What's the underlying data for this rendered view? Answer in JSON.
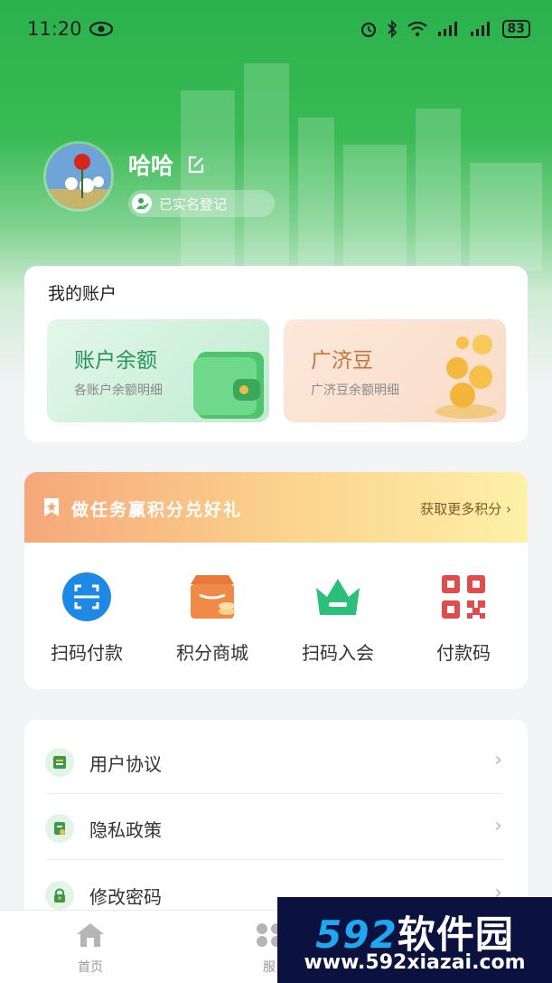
{
  "status_bar": {
    "time": "11:20",
    "battery": "83"
  },
  "profile": {
    "username": "哈哈",
    "verify_status": "已实名登记"
  },
  "account": {
    "title": "我的账户",
    "balance": {
      "title": "账户余额",
      "subtitle": "各账户余额明细"
    },
    "beans": {
      "title": "广济豆",
      "subtitle": "广济豆余额明细"
    }
  },
  "task_banner": {
    "text": "做任务赢积分兑好礼",
    "more": "获取更多积分"
  },
  "shortcuts": [
    {
      "label": "扫码付款",
      "icon": "scan-pay-icon"
    },
    {
      "label": "积分商城",
      "icon": "points-mall-icon"
    },
    {
      "label": "扫码入会",
      "icon": "crown-icon"
    },
    {
      "label": "付款码",
      "icon": "qr-code-icon"
    }
  ],
  "menu": [
    {
      "label": "用户协议",
      "icon": "agreement-icon"
    },
    {
      "label": "隐私政策",
      "icon": "privacy-icon"
    },
    {
      "label": "修改密码",
      "icon": "lock-icon"
    }
  ],
  "tabbar": [
    {
      "label": "首页",
      "icon": "home-icon"
    },
    {
      "label": "服",
      "icon": "service-icon"
    }
  ],
  "watermark": {
    "digits": "592",
    "brand": "软件园",
    "url": "www.592xiazai.com"
  },
  "colors": {
    "primary_green": "#2bb24c",
    "orange_accent": "#e56a4a"
  }
}
